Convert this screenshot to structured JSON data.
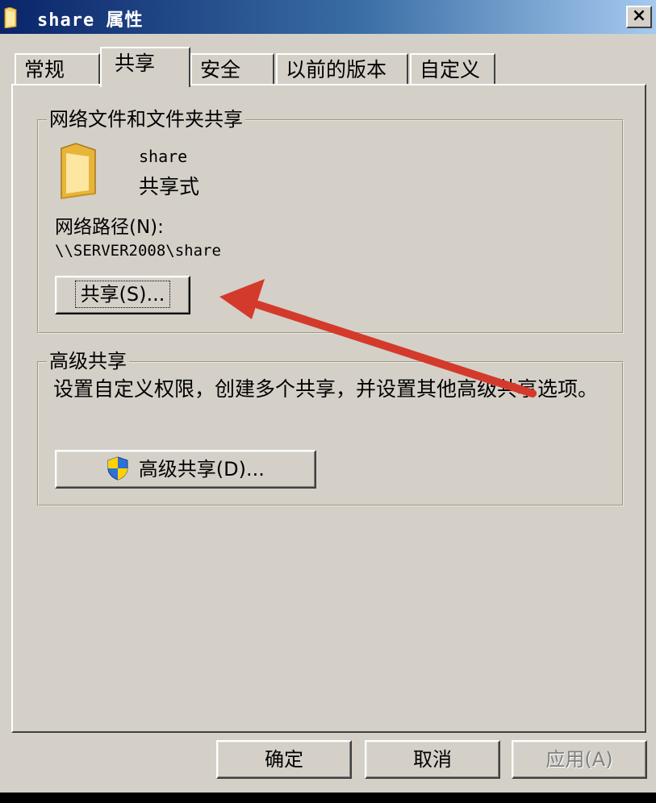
{
  "window": {
    "title": "share 属性",
    "close_label": "×"
  },
  "tabs": [
    {
      "label": "常规",
      "active": false
    },
    {
      "label": "共享",
      "active": true
    },
    {
      "label": "安全",
      "active": false
    },
    {
      "label": "以前的版本",
      "active": false
    },
    {
      "label": "自定义",
      "active": false
    }
  ],
  "network_sharing": {
    "legend": "网络文件和文件夹共享",
    "folder_name": "share",
    "share_status": "共享式",
    "path_label": "网络路径(N):",
    "path_value": "\\\\SERVER2008\\share",
    "share_button": "共享(S)..."
  },
  "advanced_sharing": {
    "legend": "高级共享",
    "description": "设置自定义权限，创建多个共享，并设置其他高级共享选项。",
    "button": "高级共享(D)..."
  },
  "footer": {
    "ok": "确定",
    "cancel": "取消",
    "apply": "应用(A)"
  },
  "colors": {
    "annotation_arrow": "#d43a2c",
    "dialog_background": "#d4d0c8",
    "titlebar_start": "#0a246a"
  },
  "icons": [
    "folder-icon",
    "uac-shield-icon",
    "close-icon"
  ]
}
